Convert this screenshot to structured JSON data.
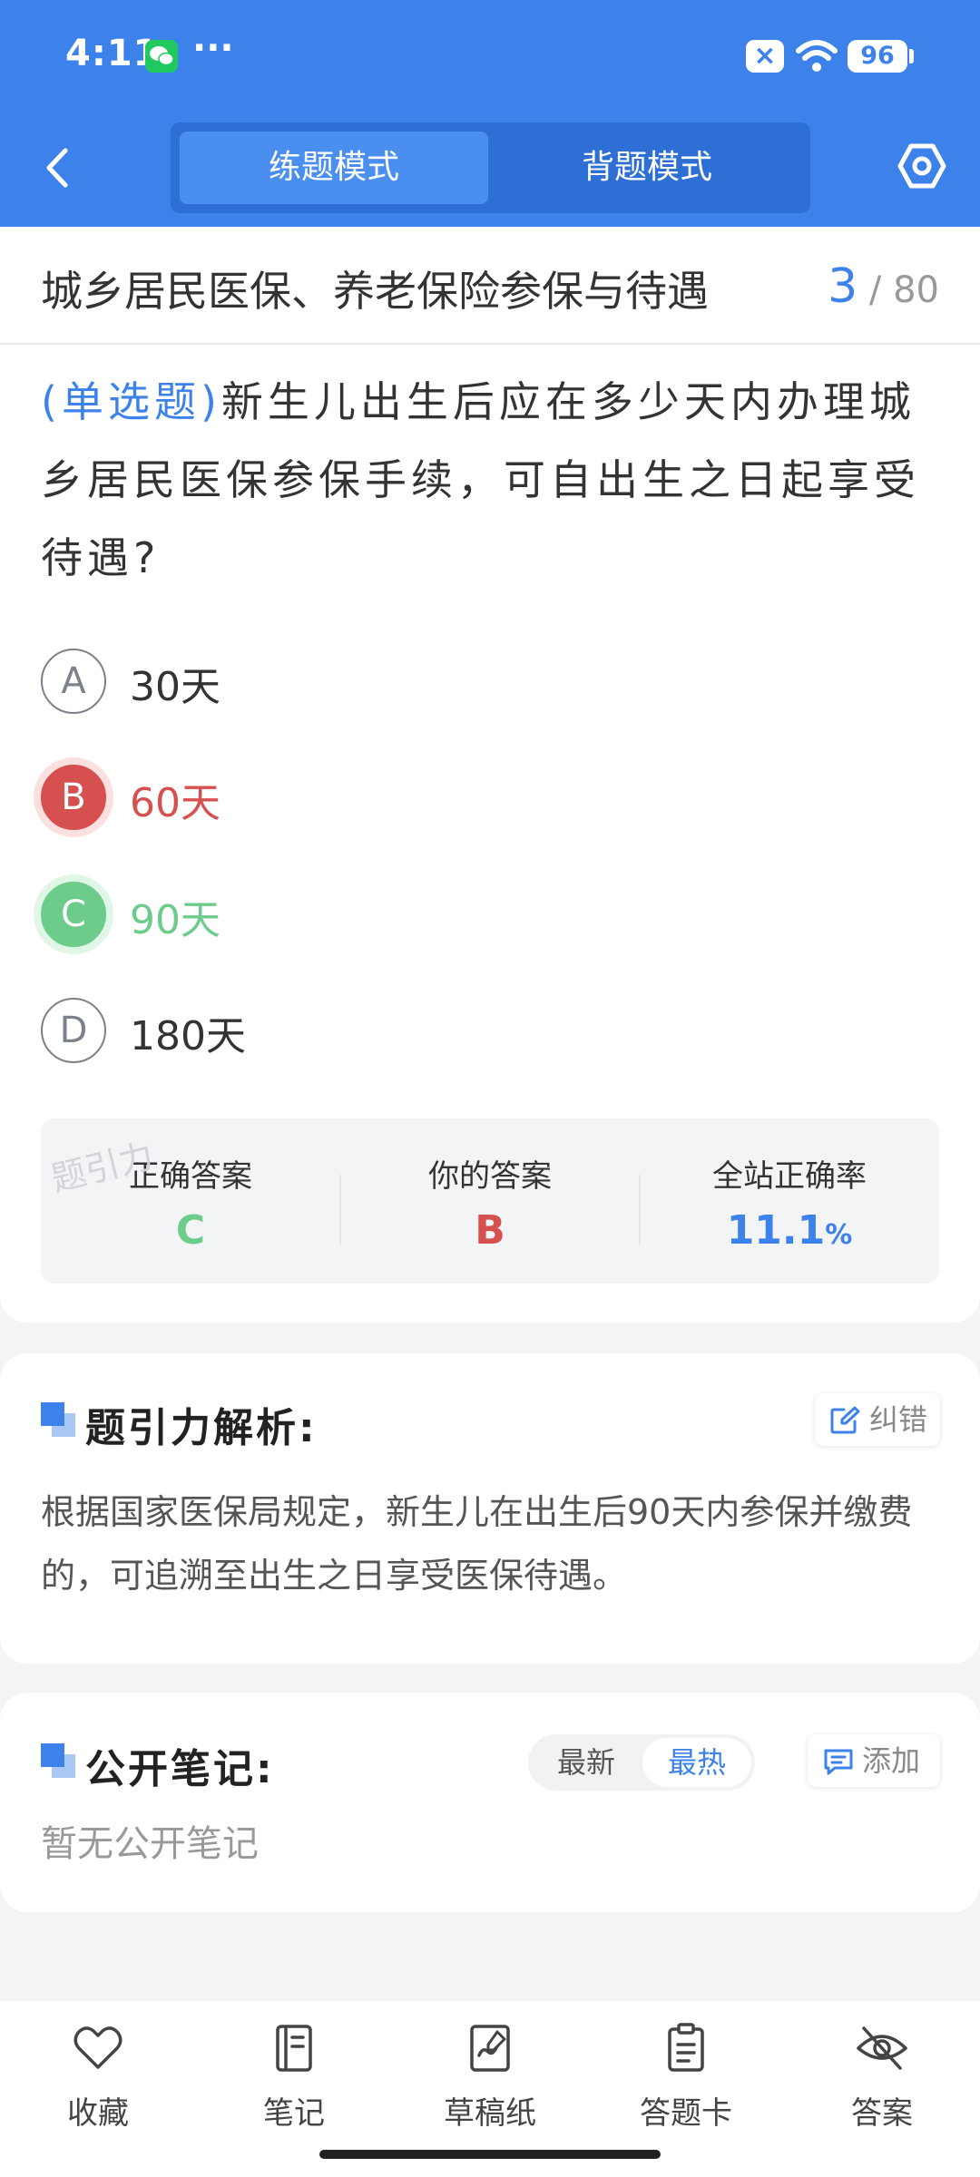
{
  "status_bar": {
    "time": "4:11",
    "dots": "···",
    "x_badge": "×",
    "battery": "96"
  },
  "header": {
    "tabs": [
      "练题模式",
      "背题模式"
    ],
    "active_tab": 0
  },
  "chapter": {
    "title": "城乡居民医保、养老保险参保与待遇",
    "current": "3",
    "separator": "/",
    "total": "80"
  },
  "question": {
    "type_label": "(单选题)",
    "text": "新生儿出生后应在多少天内办理城乡居民医保参保手续，可自出生之日起享受待遇?",
    "options": [
      {
        "letter": "A",
        "text": "30天",
        "state": "normal"
      },
      {
        "letter": "B",
        "text": "60天",
        "state": "wrong"
      },
      {
        "letter": "C",
        "text": "90天",
        "state": "correct"
      },
      {
        "letter": "D",
        "text": "180天",
        "state": "normal"
      }
    ]
  },
  "stats": {
    "correct_label": "正确答案",
    "correct_value": "C",
    "yours_label": "你的答案",
    "yours_value": "B",
    "rate_label": "全站正确率",
    "rate_value": "11.1",
    "rate_unit": "%",
    "watermark": "题引力"
  },
  "analysis": {
    "title": "题引力解析:",
    "correct_button": "纠错",
    "text": "根据国家医保局规定，新生儿在出生后90天内参保并缴费的，可追溯至出生之日享受医保待遇。"
  },
  "notes": {
    "title": "公开笔记:",
    "sort_latest": "最新",
    "sort_hot": "最热",
    "add_button": "添加",
    "empty": "暂无公开笔记"
  },
  "bottom_nav": [
    {
      "label": "收藏",
      "icon": "heart-icon"
    },
    {
      "label": "笔记",
      "icon": "notebook-icon"
    },
    {
      "label": "草稿纸",
      "icon": "draft-paper-icon"
    },
    {
      "label": "答题卡",
      "icon": "answer-card-icon"
    },
    {
      "label": "答案",
      "icon": "eye-off-icon"
    }
  ],
  "colors": {
    "primary": "#3d82eb",
    "wrong": "#d65050",
    "correct": "#6dcc8c"
  }
}
